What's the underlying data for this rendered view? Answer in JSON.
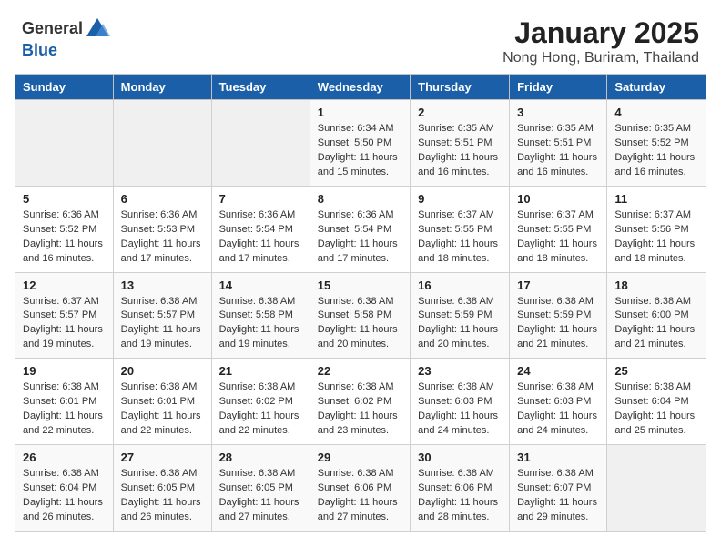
{
  "header": {
    "logo_general": "General",
    "logo_blue": "Blue",
    "title": "January 2025",
    "subtitle": "Nong Hong, Buriram, Thailand"
  },
  "weekdays": [
    "Sunday",
    "Monday",
    "Tuesday",
    "Wednesday",
    "Thursday",
    "Friday",
    "Saturday"
  ],
  "weeks": [
    [
      {
        "day": "",
        "info": ""
      },
      {
        "day": "",
        "info": ""
      },
      {
        "day": "",
        "info": ""
      },
      {
        "day": "1",
        "info": "Sunrise: 6:34 AM\nSunset: 5:50 PM\nDaylight: 11 hours and 15 minutes."
      },
      {
        "day": "2",
        "info": "Sunrise: 6:35 AM\nSunset: 5:51 PM\nDaylight: 11 hours and 16 minutes."
      },
      {
        "day": "3",
        "info": "Sunrise: 6:35 AM\nSunset: 5:51 PM\nDaylight: 11 hours and 16 minutes."
      },
      {
        "day": "4",
        "info": "Sunrise: 6:35 AM\nSunset: 5:52 PM\nDaylight: 11 hours and 16 minutes."
      }
    ],
    [
      {
        "day": "5",
        "info": "Sunrise: 6:36 AM\nSunset: 5:52 PM\nDaylight: 11 hours and 16 minutes."
      },
      {
        "day": "6",
        "info": "Sunrise: 6:36 AM\nSunset: 5:53 PM\nDaylight: 11 hours and 17 minutes."
      },
      {
        "day": "7",
        "info": "Sunrise: 6:36 AM\nSunset: 5:54 PM\nDaylight: 11 hours and 17 minutes."
      },
      {
        "day": "8",
        "info": "Sunrise: 6:36 AM\nSunset: 5:54 PM\nDaylight: 11 hours and 17 minutes."
      },
      {
        "day": "9",
        "info": "Sunrise: 6:37 AM\nSunset: 5:55 PM\nDaylight: 11 hours and 18 minutes."
      },
      {
        "day": "10",
        "info": "Sunrise: 6:37 AM\nSunset: 5:55 PM\nDaylight: 11 hours and 18 minutes."
      },
      {
        "day": "11",
        "info": "Sunrise: 6:37 AM\nSunset: 5:56 PM\nDaylight: 11 hours and 18 minutes."
      }
    ],
    [
      {
        "day": "12",
        "info": "Sunrise: 6:37 AM\nSunset: 5:57 PM\nDaylight: 11 hours and 19 minutes."
      },
      {
        "day": "13",
        "info": "Sunrise: 6:38 AM\nSunset: 5:57 PM\nDaylight: 11 hours and 19 minutes."
      },
      {
        "day": "14",
        "info": "Sunrise: 6:38 AM\nSunset: 5:58 PM\nDaylight: 11 hours and 19 minutes."
      },
      {
        "day": "15",
        "info": "Sunrise: 6:38 AM\nSunset: 5:58 PM\nDaylight: 11 hours and 20 minutes."
      },
      {
        "day": "16",
        "info": "Sunrise: 6:38 AM\nSunset: 5:59 PM\nDaylight: 11 hours and 20 minutes."
      },
      {
        "day": "17",
        "info": "Sunrise: 6:38 AM\nSunset: 5:59 PM\nDaylight: 11 hours and 21 minutes."
      },
      {
        "day": "18",
        "info": "Sunrise: 6:38 AM\nSunset: 6:00 PM\nDaylight: 11 hours and 21 minutes."
      }
    ],
    [
      {
        "day": "19",
        "info": "Sunrise: 6:38 AM\nSunset: 6:01 PM\nDaylight: 11 hours and 22 minutes."
      },
      {
        "day": "20",
        "info": "Sunrise: 6:38 AM\nSunset: 6:01 PM\nDaylight: 11 hours and 22 minutes."
      },
      {
        "day": "21",
        "info": "Sunrise: 6:38 AM\nSunset: 6:02 PM\nDaylight: 11 hours and 22 minutes."
      },
      {
        "day": "22",
        "info": "Sunrise: 6:38 AM\nSunset: 6:02 PM\nDaylight: 11 hours and 23 minutes."
      },
      {
        "day": "23",
        "info": "Sunrise: 6:38 AM\nSunset: 6:03 PM\nDaylight: 11 hours and 24 minutes."
      },
      {
        "day": "24",
        "info": "Sunrise: 6:38 AM\nSunset: 6:03 PM\nDaylight: 11 hours and 24 minutes."
      },
      {
        "day": "25",
        "info": "Sunrise: 6:38 AM\nSunset: 6:04 PM\nDaylight: 11 hours and 25 minutes."
      }
    ],
    [
      {
        "day": "26",
        "info": "Sunrise: 6:38 AM\nSunset: 6:04 PM\nDaylight: 11 hours and 26 minutes."
      },
      {
        "day": "27",
        "info": "Sunrise: 6:38 AM\nSunset: 6:05 PM\nDaylight: 11 hours and 26 minutes."
      },
      {
        "day": "28",
        "info": "Sunrise: 6:38 AM\nSunset: 6:05 PM\nDaylight: 11 hours and 27 minutes."
      },
      {
        "day": "29",
        "info": "Sunrise: 6:38 AM\nSunset: 6:06 PM\nDaylight: 11 hours and 27 minutes."
      },
      {
        "day": "30",
        "info": "Sunrise: 6:38 AM\nSunset: 6:06 PM\nDaylight: 11 hours and 28 minutes."
      },
      {
        "day": "31",
        "info": "Sunrise: 6:38 AM\nSunset: 6:07 PM\nDaylight: 11 hours and 29 minutes."
      },
      {
        "day": "",
        "info": ""
      }
    ]
  ]
}
